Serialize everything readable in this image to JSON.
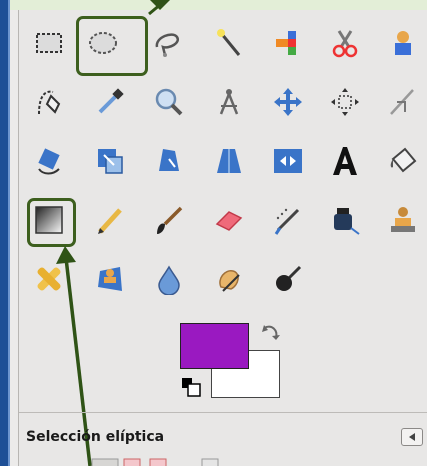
{
  "colors": {
    "foreground": "#9a19c1",
    "background": "#ffffff",
    "highlight": "#3d5f1e"
  },
  "toolbox": {
    "tools": [
      {
        "name": "rect-select-icon"
      },
      {
        "name": "ellipse-select-icon"
      },
      {
        "name": "free-select-icon"
      },
      {
        "name": "fuzzy-select-icon"
      },
      {
        "name": "color-select-icon"
      },
      {
        "name": "scissors-select-icon"
      },
      {
        "name": "foreground-select-icon"
      },
      {
        "name": "paths-icon"
      },
      {
        "name": "color-picker-icon"
      },
      {
        "name": "zoom-icon"
      },
      {
        "name": "measure-icon"
      },
      {
        "name": "move-icon"
      },
      {
        "name": "align-icon"
      },
      {
        "name": "crop-icon"
      },
      {
        "name": "rotate-icon"
      },
      {
        "name": "scale-icon"
      },
      {
        "name": "shear-icon"
      },
      {
        "name": "perspective-icon"
      },
      {
        "name": "flip-icon"
      },
      {
        "name": "text-icon"
      },
      {
        "name": "bucket-fill-icon"
      },
      {
        "name": "blend-icon"
      },
      {
        "name": "pencil-icon"
      },
      {
        "name": "paintbrush-icon"
      },
      {
        "name": "eraser-icon"
      },
      {
        "name": "airbrush-icon"
      },
      {
        "name": "ink-icon"
      },
      {
        "name": "clone-icon"
      },
      {
        "name": "heal-icon"
      },
      {
        "name": "perspective-clone-icon"
      },
      {
        "name": "blur-sharpen-icon"
      },
      {
        "name": "smudge-icon"
      },
      {
        "name": "dodge-burn-icon"
      }
    ]
  },
  "tool_options": {
    "title": "Selección elíptica"
  }
}
